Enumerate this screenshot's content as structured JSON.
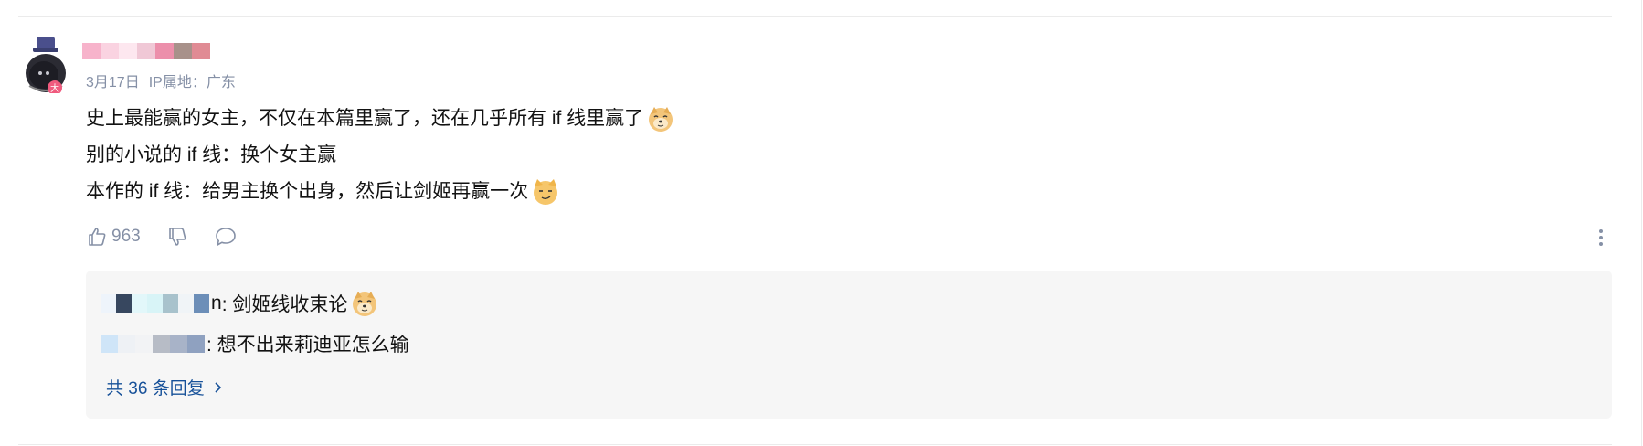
{
  "comment": {
    "username_blurred": true,
    "username_blur_colors": [
      "#f7b3cb",
      "#fad3e1",
      "#fde7ef",
      "#f0c8d6",
      "#ec8fab",
      "#a8918a",
      "#e08b94"
    ],
    "avatar_badge_text": "大",
    "date": "3月17日",
    "ip_location": "IP属地：广东",
    "content_lines": [
      "史上最能赢的女主，不仅在本篇里赢了，还在几乎所有 if 线里赢了",
      "别的小说的 if 线：换个女主赢",
      "本作的 if 线：给男主换个出身，然后让剑姬再赢一次"
    ],
    "emojis": [
      "doge-emoji",
      "cat-smirk-emoji"
    ],
    "like_count": "963"
  },
  "replies": [
    {
      "name_tail": "n",
      "text": ": 剑姬线收束论",
      "emoji": "doge-emoji",
      "blur_colors": [
        "#eef4fb",
        "#37475f",
        "#e2f7fa",
        "#d8f4f7",
        "#a8c2cc",
        "#f0f4f7",
        "#6c8eb8"
      ]
    },
    {
      "name_tail": "",
      "text": ": 想不出来莉迪亚怎么输",
      "blur_colors": [
        "#cfe5f8",
        "#eef1f5",
        "#f2f3f5",
        "#b7bcc6",
        "#a8b3c8",
        "#8fa1c0"
      ]
    }
  ],
  "more_replies_label": "共 36 条回复",
  "colors": {
    "meta": "#8590a6",
    "link": "#175199",
    "reply_bg": "#f6f6f6"
  }
}
